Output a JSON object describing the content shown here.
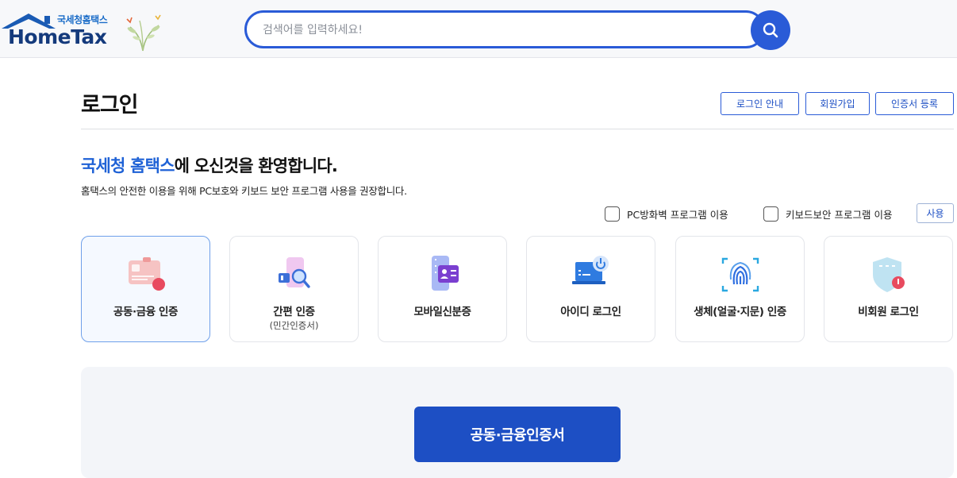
{
  "header": {
    "logo_kr": "국세청홈택스",
    "logo_en": "HomeTax",
    "search": {
      "placeholder": "검색어를 입력하세요!",
      "value": ""
    }
  },
  "page": {
    "title": "로그인",
    "actions": [
      {
        "label": "로그인 안내"
      },
      {
        "label": "회원가입"
      },
      {
        "label": "인증서 등록"
      }
    ]
  },
  "welcome": {
    "accent": "국세청 홈택스",
    "rest": "에 오신것을 환영합니다.",
    "subtext": "홈택스의 안전한 이용을 위해 PC보호와 키보드 보안 프로그램 사용을 권장합니다."
  },
  "security": {
    "options": [
      {
        "label": "PC방화벽 프로그램 이용",
        "checked": false
      },
      {
        "label": "키보드보안 프로그램 이용",
        "checked": false
      }
    ],
    "apply_label": "사용"
  },
  "methods": [
    {
      "label": "공동·금융 인증",
      "sub": "",
      "icon": "certificate-card-icon",
      "active": true
    },
    {
      "label": "간편 인증",
      "sub": "(민간인증서)",
      "icon": "simple-auth-icon",
      "active": false
    },
    {
      "label": "모바일신분증",
      "sub": "",
      "icon": "mobile-id-icon",
      "active": false
    },
    {
      "label": "아이디 로그인",
      "sub": "",
      "icon": "id-login-laptop-icon",
      "active": false
    },
    {
      "label": "생체(얼굴·지문) 인증",
      "sub": "",
      "icon": "fingerprint-icon",
      "active": false
    },
    {
      "label": "비회원 로그인",
      "sub": "",
      "icon": "guest-shield-icon",
      "active": false
    }
  ],
  "primary_action": {
    "label": "공동·금융인증서"
  },
  "colors": {
    "brand": "#1d4fc4",
    "accent": "#1f62d6",
    "search_border": "#2a5bd7"
  }
}
